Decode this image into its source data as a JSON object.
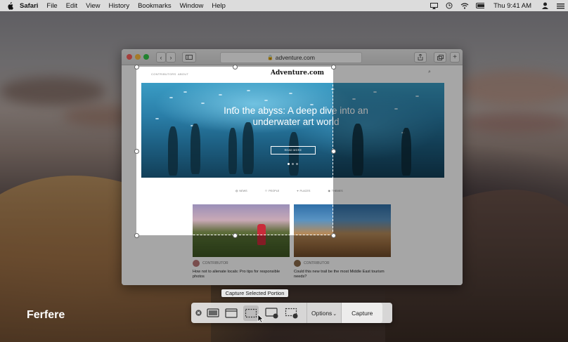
{
  "menubar": {
    "app": "Safari",
    "items": [
      "File",
      "Edit",
      "View",
      "History",
      "Bookmarks",
      "Window",
      "Help"
    ],
    "clock": "Thu 9:41 AM",
    "status_icons": [
      "airplay-icon",
      "time-machine-icon",
      "wifi-icon",
      "battery-icon",
      "user-icon",
      "menu-icon"
    ]
  },
  "browser": {
    "url": "adventure.com",
    "page": {
      "nav": [
        "CONTRIBUTORS",
        "ABOUT"
      ],
      "brand": "Adventure.com",
      "hero_title": "Into the abyss: A deep dive into an underwater art world",
      "hero_button": "READ MORE",
      "categories": [
        "NEWS",
        "PEOPLE",
        "PLACES",
        "THEMES"
      ],
      "cards": [
        {
          "author": "CONTRIBUTOR",
          "title": "How not to alienate locals: Pro tips for responsible photos"
        },
        {
          "author": "CONTRIBUTOR",
          "title": "Could this new trail be the most Middle East tourism needs?"
        }
      ]
    }
  },
  "capture": {
    "tooltip": "Capture Selected Portion",
    "options_label": "Options",
    "capture_label": "Capture",
    "tools": [
      "close-icon",
      "capture-entire-screen-icon",
      "capture-window-icon",
      "capture-selection-icon",
      "record-screen-icon",
      "record-selection-icon"
    ],
    "selected_tool": "capture-selection-icon"
  },
  "watermark": "Ferfere"
}
